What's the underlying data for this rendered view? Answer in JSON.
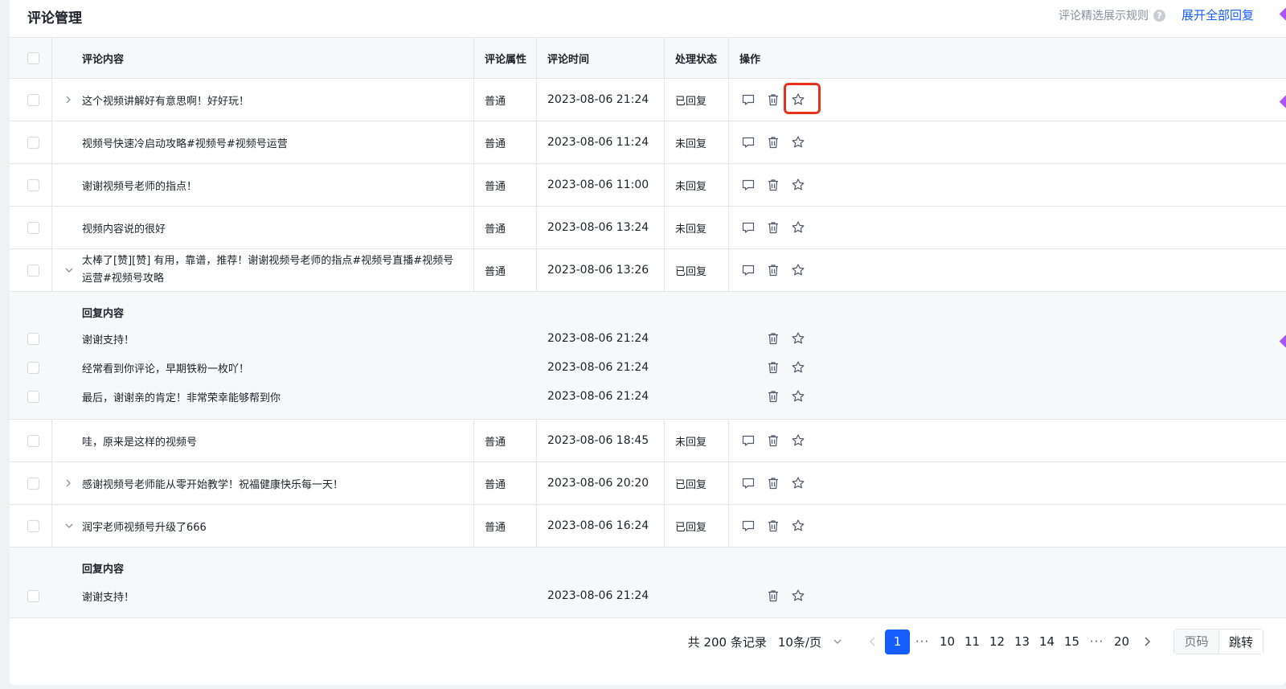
{
  "header": {
    "title": "评论管理",
    "rule_link": "评论精选展示规则",
    "expand_all": "展开全部回复"
  },
  "columns": {
    "content": "评论内容",
    "attribute": "评论属性",
    "time": "评论时间",
    "status": "处理状态",
    "actions": "操作"
  },
  "reply_header": "回复内容",
  "comments": [
    {
      "content": "这个视频讲解好有意思啊！好好玩！",
      "attribute": "普通",
      "time": "2023-08-06 21:24",
      "status": "已回复",
      "caret": "›"
    },
    {
      "content": "视频号快速冷启动攻略#视频号#视频号运营",
      "attribute": "普通",
      "time": "2023-08-06 11:24",
      "status": "未回复",
      "caret": ""
    },
    {
      "content": "谢谢视频号老师的指点！",
      "attribute": "普通",
      "time": "2023-08-06 11:00",
      "status": "未回复",
      "caret": ""
    },
    {
      "content": "视频内容说的很好",
      "attribute": "普通",
      "time": "2023-08-06 13:24",
      "status": "未回复",
      "caret": ""
    },
    {
      "content_line1": "太棒了[赞][赞] 有用，靠谱，推荐！谢谢视频号老师的指点#视频号直播#视频号",
      "content_line2": "运营#视频号攻略",
      "attribute": "普通",
      "time": "2023-08-06 13:26",
      "status": "已回复",
      "caret": "⌄"
    },
    {
      "content": "哇，原来是这样的视频号",
      "attribute": "普通",
      "time": "2023-08-06 18:45",
      "status": "未回复",
      "caret": ""
    },
    {
      "content": "感谢视频号老师能从零开始教学！祝福健康快乐每一天！",
      "attribute": "普通",
      "time": "2023-08-06 20:20",
      "status": "已回复",
      "caret": "›"
    },
    {
      "content": "润宇老师视频号升级了666",
      "attribute": "普通",
      "time": "2023-08-06 16:24",
      "status": "已回复",
      "caret": "⌄"
    }
  ],
  "replies_a": [
    {
      "content": "谢谢支持！",
      "time": "2023-08-06 21:24"
    },
    {
      "content": "经常看到你评论，早期铁粉一枚吖！",
      "time": "2023-08-06 21:24"
    },
    {
      "content": "最后，谢谢亲的肯定！非常荣幸能够帮到你",
      "time": "2023-08-06 21:24"
    }
  ],
  "replies_b": [
    {
      "content": "谢谢支持！",
      "time": "2023-08-06 21:24"
    }
  ],
  "icons": {
    "reply": "comment-icon",
    "delete": "trash-icon",
    "feature": "star-icon",
    "help": "question-circle-icon"
  },
  "pagination": {
    "total": "共 200 条记录",
    "page_size": "10条/页",
    "pages": [
      "1",
      "···",
      "10",
      "11",
      "12",
      "13",
      "14",
      "15",
      "···",
      "20"
    ],
    "current": "1",
    "jump_placeholder": "页码",
    "jump_label": "跳转"
  },
  "colors": {
    "accent": "#165dff",
    "highlight": "#e8311a",
    "marker": "#a855f7"
  }
}
